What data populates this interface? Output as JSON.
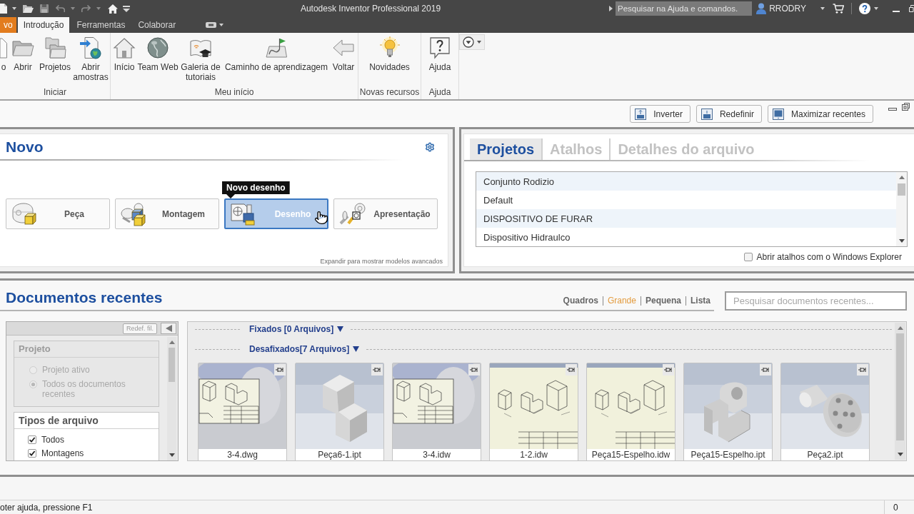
{
  "window": {
    "title": "Autodesk Inventor Professional 2019"
  },
  "help_search": {
    "placeholder": "Pesquisar na Ajuda e comandos."
  },
  "user": {
    "name": "RRODRY"
  },
  "ribbon_tabs": [
    {
      "label": "vo",
      "kind": "application",
      "selected": false
    },
    {
      "label": "Introdução",
      "kind": "tab",
      "selected": true
    },
    {
      "label": "Ferramentas",
      "kind": "tab",
      "selected": false
    },
    {
      "label": "Colaborar",
      "kind": "tab",
      "selected": false
    }
  ],
  "ribbon_panels": [
    {
      "title": "Iniciar",
      "buttons": [
        "o",
        "Abrir",
        "Projetos",
        "Abrir amostras"
      ]
    },
    {
      "title": "Meu início",
      "buttons": [
        "Início",
        "Team Web",
        "Galeria de tutoriais",
        "Caminho de aprendizagem",
        "Voltar"
      ]
    },
    {
      "title": "Novas recursos",
      "buttons": [
        "Novidades"
      ]
    },
    {
      "title": "Ajuda",
      "buttons": [
        "Ajuda"
      ]
    }
  ],
  "view_buttons": [
    "Inverter",
    "Redefinir",
    "Maximizar recentes"
  ],
  "new_panel": {
    "title": "Novo",
    "templates": [
      {
        "label": "Peça",
        "hovered": false
      },
      {
        "label": "Montagem",
        "hovered": false
      },
      {
        "label": "Desenho",
        "hovered": true
      },
      {
        "label": "Apresentação",
        "hovered": false
      }
    ],
    "tooltip": "Novo desenho",
    "expand_hint": "Expandir para mostrar modelos avancados"
  },
  "projects_panel": {
    "tabs": [
      {
        "label": "Projetos",
        "selected": true
      },
      {
        "label": "Atalhos",
        "selected": false
      },
      {
        "label": "Detalhes do arquivo",
        "selected": false
      }
    ],
    "projects": [
      "Conjunto Rodizio",
      "Default",
      "DISPOSITIVO DE FURAR",
      "Dispositivo Hidraulco"
    ],
    "explorer_option": {
      "label": "Abrir atalhos com o Windows Explorer",
      "checked": false
    }
  },
  "recent_documents": {
    "title": "Documentos recentes",
    "views": [
      {
        "label": "Quadros",
        "selected": false
      },
      {
        "label": "Grande",
        "selected": true
      },
      {
        "label": "Pequena",
        "selected": false
      },
      {
        "label": "Lista",
        "selected": false
      }
    ],
    "search": {
      "placeholder": "Pesquisar documentos recentes..."
    },
    "filter": {
      "reset_button": "Redef. fil.",
      "project": {
        "title": "Projeto",
        "disabled": true,
        "options": [
          {
            "label": "Projeto ativo",
            "selected": false
          },
          {
            "label": "Todos os documentos recentes",
            "selected": true
          }
        ]
      },
      "file_types": {
        "title": "Tipos de arquivo",
        "options": [
          {
            "label": "Todos",
            "checked": true
          },
          {
            "label": "Montagens",
            "checked": true
          }
        ]
      }
    },
    "pinned": {
      "label": "Fixados [0 Arquivos]"
    },
    "unpinned": {
      "label": "Desafixados[7 Arquivos]",
      "files": [
        {
          "name": "3-4.dwg",
          "kind": "sheet_inset"
        },
        {
          "name": "Peça6-1.ipt",
          "kind": "block_model"
        },
        {
          "name": "3-4.idw",
          "kind": "sheet_inset"
        },
        {
          "name": "1-2.idw",
          "kind": "sheet"
        },
        {
          "name": "Peça15-Espelho.idw",
          "kind": "sheet"
        },
        {
          "name": "Peça15-Espelho.ipt",
          "kind": "bracket_model"
        },
        {
          "name": "Peça2.ipt",
          "kind": "shaft_model"
        }
      ]
    }
  },
  "status_bar": {
    "help_text": "oter ajuda, pressione F1",
    "count": "0"
  }
}
